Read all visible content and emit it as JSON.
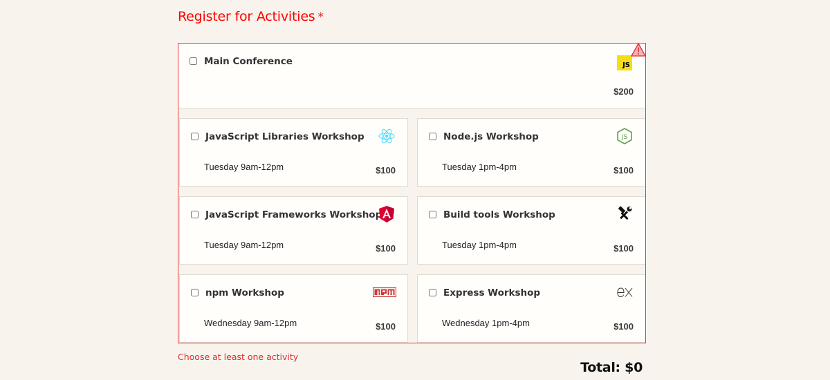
{
  "section": {
    "legend": "Register for Activities",
    "required_marker": "*"
  },
  "activities": {
    "main": {
      "name": "Main Conference",
      "cost": "$200",
      "logo_text": "JS",
      "checked": false
    },
    "workshops": [
      {
        "name": "JavaScript Libraries Workshop",
        "time": "Tuesday 9am-12pm",
        "cost": "$100",
        "icon": "react-icon",
        "checked": false
      },
      {
        "name": "Node.js Workshop",
        "time": "Tuesday 1pm-4pm",
        "cost": "$100",
        "icon": "nodejs-icon",
        "checked": false
      },
      {
        "name": "JavaScript Frameworks Workshop",
        "time": "Tuesday 9am-12pm",
        "cost": "$100",
        "icon": "angular-icon",
        "checked": false
      },
      {
        "name": "Build tools Workshop",
        "time": "Tuesday 1pm-4pm",
        "cost": "$100",
        "icon": "tools-icon",
        "checked": false
      },
      {
        "name": "npm Workshop",
        "time": "Wednesday 9am-12pm",
        "cost": "$100",
        "icon": "npm-icon",
        "checked": false
      },
      {
        "name": "Express Workshop",
        "time": "Wednesday 1pm-4pm",
        "cost": "$100",
        "icon": "express-icon",
        "checked": false
      }
    ]
  },
  "validation": {
    "error": "Choose at least one activity"
  },
  "total": {
    "label": "Total: $0"
  },
  "colors": {
    "error_red": "#e42a30",
    "background": "#f8f4ed",
    "card_bg": "#fffefb",
    "js_yellow": "#f5de19",
    "react_cyan": "#61dafb",
    "node_green": "#5fa04e",
    "angular_red": "#dd0031",
    "npm_red": "#cb3837"
  }
}
